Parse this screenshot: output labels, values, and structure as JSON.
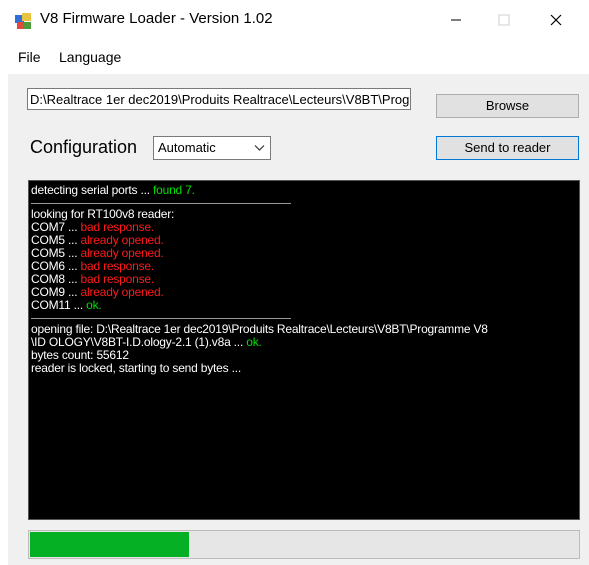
{
  "window": {
    "title": "V8 Firmware Loader - Version 1.02",
    "icons": [
      "app-icon",
      "minimize-icon",
      "maximize-icon",
      "close-icon"
    ]
  },
  "menu": {
    "items": [
      "File",
      "Language"
    ]
  },
  "file_path": {
    "value": "D:\\Realtrace 1er dec2019\\Produits Realtrace\\Lecteurs\\V8BT\\Prog"
  },
  "buttons": {
    "browse": "Browse",
    "send": "Send to reader"
  },
  "configuration": {
    "label": "Configuration",
    "selected": "Automatic"
  },
  "console": {
    "detect_prefix": "detecting serial ports ... ",
    "detect_result": "found 7.",
    "looking": "looking for RT100v8 reader:",
    "ports": [
      {
        "name": "COM7 ... ",
        "result": "bad response.",
        "status": "bad"
      },
      {
        "name": "COM5 ... ",
        "result": "already opened.",
        "status": "bad"
      },
      {
        "name": "COM5 ... ",
        "result": "already opened.",
        "status": "bad"
      },
      {
        "name": "COM6 ... ",
        "result": "bad response.",
        "status": "bad"
      },
      {
        "name": "COM8 ... ",
        "result": "bad response.",
        "status": "bad"
      },
      {
        "name": "COM9 ... ",
        "result": "already opened.",
        "status": "bad"
      },
      {
        "name": "COM11 ... ",
        "result": "ok.",
        "status": "ok"
      }
    ],
    "opening_line1": "opening file: D:\\Realtrace 1er dec2019\\Produits Realtrace\\Lecteurs\\V8BT\\Programme V8",
    "opening_line2": "\\ID OLOGY\\V8BT-I.D.ology-2.1 (1).v8a ... ",
    "opening_result": "ok.",
    "bytes": "bytes count: 55612",
    "status_line": "reader is locked, starting to send bytes ..."
  },
  "progress": {
    "fraction": 0.29
  },
  "colors": {
    "ok": "#00e000",
    "bad": "#ff1a1a",
    "progress": "#06b025",
    "console_bg": "#000000"
  }
}
